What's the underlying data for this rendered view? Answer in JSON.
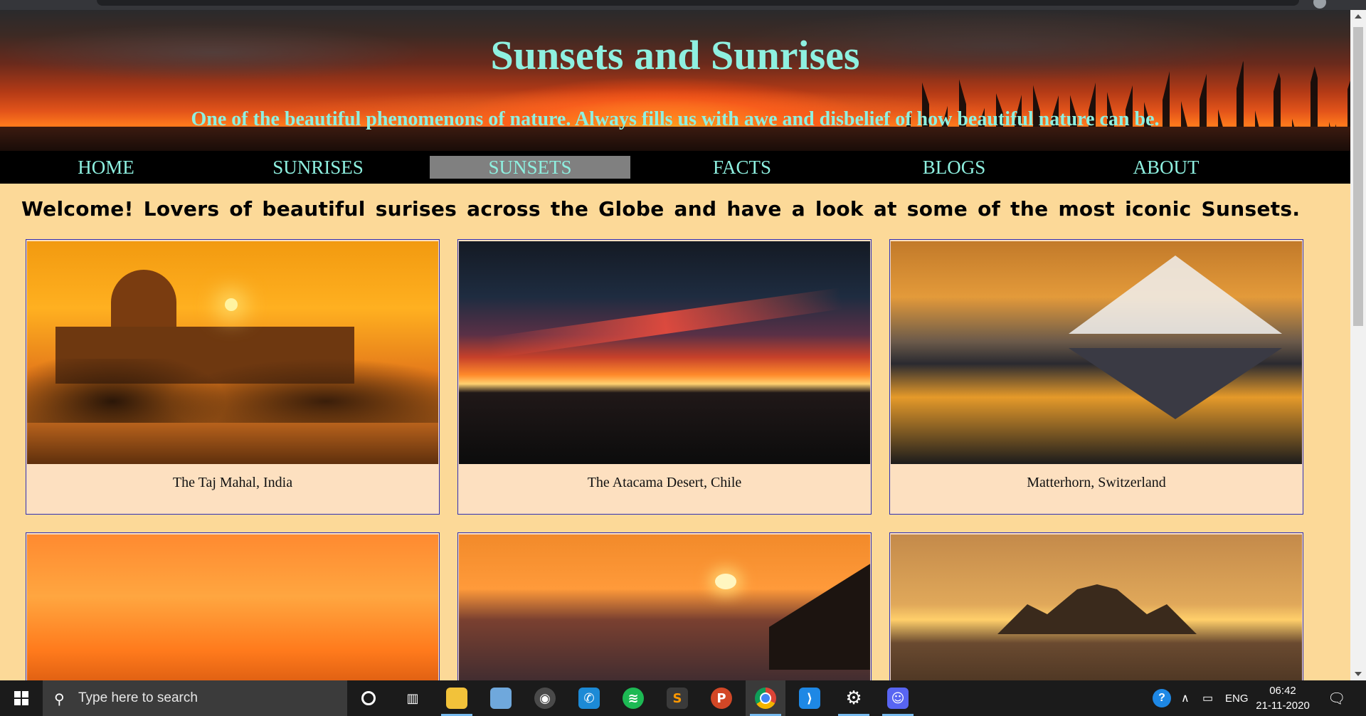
{
  "header": {
    "title": "Sunsets and Sunrises",
    "subtitle": "One of the beautiful phenomenons of nature. Always fills us with awe and disbelief of how beautiful nature can be."
  },
  "nav": {
    "items": [
      {
        "label": "HOME",
        "active": false
      },
      {
        "label": "SUNRISES",
        "active": false
      },
      {
        "label": "SUNSETS",
        "active": true
      },
      {
        "label": "FACTS",
        "active": false
      },
      {
        "label": "BLOGS",
        "active": false
      },
      {
        "label": "ABOUT",
        "active": false
      }
    ]
  },
  "welcome": "Welcome! Lovers of beautiful surises across the Globe and have a look at some of the most iconic Sunsets.",
  "gallery": [
    {
      "caption": "The Taj Mahal, India"
    },
    {
      "caption": "The Atacama Desert, Chile"
    },
    {
      "caption": "Matterhorn, Switzerland"
    },
    {
      "caption": ""
    },
    {
      "caption": ""
    },
    {
      "caption": ""
    }
  ],
  "taskbar": {
    "search_placeholder": "Type here to search",
    "apps": [
      "cortana-icon",
      "task-view-icon",
      "file-explorer-icon",
      "notepad-icon",
      "obs-icon",
      "whatsapp-icon",
      "spotify-icon",
      "sublime-text-icon",
      "powerpoint-icon",
      "chrome-icon",
      "vscode-icon",
      "settings-icon",
      "discord-icon"
    ],
    "language": "ENG",
    "time": "06:42",
    "date": "21-11-2020"
  },
  "colors": {
    "page_bg": "#fcd998",
    "nav_bg": "#000000",
    "nav_text": "#8ef0e0",
    "nav_active_bg": "#808080",
    "card_bg": "#fde0c0",
    "card_border": "#2f2fb4"
  }
}
